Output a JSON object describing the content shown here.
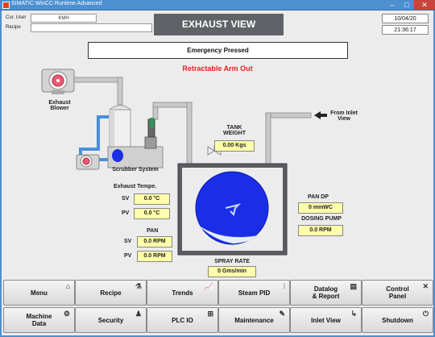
{
  "window": {
    "title": "SIMATIC WinCC Runtime Advanced",
    "min": "–",
    "max": "□",
    "close": "✕"
  },
  "header": {
    "cur_user_label": "Cur. User",
    "cur_user_value": "KMH",
    "recipe_label": "Recipe",
    "recipe_value": "",
    "screen_title": "EXHAUST VIEW",
    "date": "10/04/20",
    "time": "21:36:17"
  },
  "status": {
    "emergency": "Emergency Pressed",
    "alarm": "Retractable Arm Out"
  },
  "process": {
    "exhaust_blower": "Exhaust\nBlower",
    "scrubber_system": "Scrubber System",
    "from_inlet": "From Inlet\nView",
    "tank_weight_label": "TANK\nWEIGHT",
    "tank_weight_value": "0.00 Kgs",
    "exhaust_temp_label": "Exhaust Tempe.",
    "sv_label": "SV",
    "pv_label": "PV",
    "exhaust_sv": "0.0 °C",
    "exhaust_pv": "0.0 °C",
    "pan_label": "PAN",
    "pan_sv": "0.0 RPM",
    "pan_pv": "0.0 RPM",
    "pan_sv_label": "SV",
    "pan_pv_label": "PV",
    "spray_rate_label": "SPRAY RATE",
    "spray_rate_value": "0 Gms/min",
    "pan_dp_label": "PAN DP",
    "pan_dp_value": "0 mmWC",
    "dosing_pump_label": "DOSING PUMP",
    "dosing_pump_value": "0.0 RPM"
  },
  "colors": {
    "pan_blue": "#1a2ee8",
    "alarm_red": "#e8221a",
    "value_yellow": "#ffffaa",
    "pipe_blue": "#4a8fdc"
  },
  "nav": {
    "row1": [
      {
        "label": "Menu",
        "icon": "home-icon",
        "glyph": "⌂"
      },
      {
        "label": "Recipe",
        "icon": "recipe-icon",
        "glyph": "⚗"
      },
      {
        "label": "Trends",
        "icon": "trends-icon",
        "glyph": "📈"
      },
      {
        "label": "Steam PID",
        "icon": "sliders-icon",
        "glyph": "⫶"
      },
      {
        "label": "Datalog\n& Report",
        "icon": "report-icon",
        "glyph": "▤"
      },
      {
        "label": "Control\nPanel",
        "icon": "tools-icon",
        "glyph": "✕"
      }
    ],
    "row2": [
      {
        "label": "Machine\nData",
        "icon": "machine-data-icon",
        "glyph": "⚙"
      },
      {
        "label": "Security",
        "icon": "user-icon",
        "glyph": "♟"
      },
      {
        "label": "PLC IO",
        "icon": "plc-icon",
        "glyph": "⊞"
      },
      {
        "label": "Maintenance",
        "icon": "wrench-icon",
        "glyph": "✎"
      },
      {
        "label": "Inlet View",
        "icon": "inlet-icon",
        "glyph": "↳"
      },
      {
        "label": "Shutdown",
        "icon": "power-icon",
        "glyph": "⏻"
      }
    ]
  }
}
